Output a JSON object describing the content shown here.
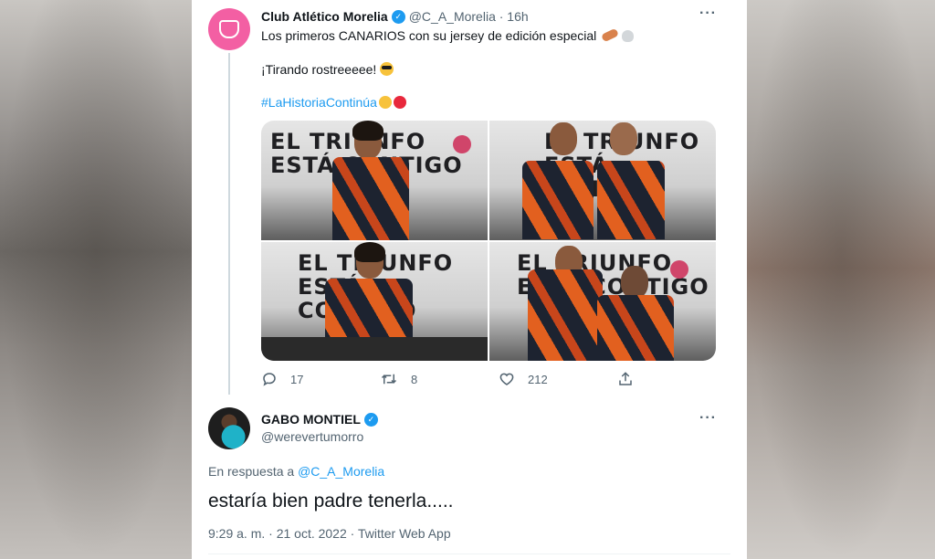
{
  "tweet": {
    "author_name": "Club Atlético Morelia",
    "handle_time": "@C_A_Morelia · 16h",
    "line1": "Los primeros CANARIOS con su jersey de edición especial",
    "line2": "¡Tirando rostreeeee!",
    "hashtag": "#LaHistoriaContinúa",
    "photo_wall_texts": [
      "EL TRIUNFO\nESTÁ CONTIGO",
      "EL TRIUNFO\nESTÁ CONTIGO",
      "EL TRIUNFO\nESTÁ CONTIGO",
      "EL TRIUNFO\nESTÁ CONTIGO"
    ],
    "stats": {
      "replies": "17",
      "retweets": "8",
      "likes": "212"
    }
  },
  "reply": {
    "author_name": "GABO MONTIEL",
    "handle": "@werevertumorro",
    "in_reply_prefix": "En respuesta a",
    "in_reply_mention": "@C_A_Morelia",
    "text": "estaría bien padre tenerla.....",
    "meta": "9:29 a. m. · 21 oct. 2022 · Twitter Web App"
  },
  "colors": {
    "accent": "#1d9bf0",
    "morelia_avatar": "#f35fa3"
  },
  "icons": [
    "verified-badge-icon",
    "more-options-icon",
    "reply-icon",
    "retweet-icon",
    "like-icon",
    "share-icon"
  ]
}
